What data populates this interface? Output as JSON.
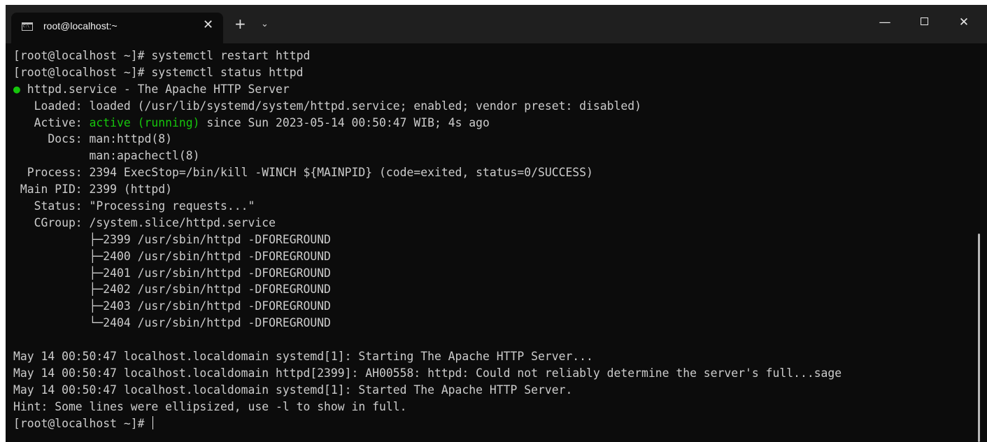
{
  "window": {
    "tab_title": "root@localhost:~",
    "tab_icon": "terminal-icon",
    "close_tab_glyph": "✕",
    "new_tab_glyph": "+",
    "dropdown_glyph": "⌄",
    "minimize_glyph": "—",
    "close_glyph": "✕"
  },
  "colors": {
    "background": "#0c0c0c",
    "titlebar": "#1f1f1f",
    "text": "#cccccc",
    "status_green": "#16c60c"
  },
  "terminal": {
    "lines": [
      "[root@localhost ~]# systemctl restart httpd",
      "[root@localhost ~]# systemctl status httpd",
      " httpd.service - The Apache HTTP Server",
      "   Loaded: loaded (/usr/lib/systemd/system/httpd.service; enabled; vendor preset: disabled)",
      "   Active: ",
      "     Docs: man:httpd(8)",
      "           man:apachectl(8)",
      "  Process: 2394 ExecStop=/bin/kill -WINCH ${MAINPID} (code=exited, status=0/SUCCESS)",
      " Main PID: 2399 (httpd)",
      "   Status: \"Processing requests...\"",
      "   CGroup: /system.slice/httpd.service",
      "           ├─2399 /usr/sbin/httpd -DFOREGROUND",
      "           ├─2400 /usr/sbin/httpd -DFOREGROUND",
      "           ├─2401 /usr/sbin/httpd -DFOREGROUND",
      "           ├─2402 /usr/sbin/httpd -DFOREGROUND",
      "           ├─2403 /usr/sbin/httpd -DFOREGROUND",
      "           └─2404 /usr/sbin/httpd -DFOREGROUND",
      "",
      "May 14 00:50:47 localhost.localdomain systemd[1]: Starting The Apache HTTP Server...",
      "May 14 00:50:47 localhost.localdomain httpd[2399]: AH00558: httpd: Could not reliably determine the server's full...sage",
      "May 14 00:50:47 localhost.localdomain systemd[1]: Started The Apache HTTP Server.",
      "Hint: Some lines were ellipsized, use -l to show in full.",
      "[root@localhost ~]# "
    ],
    "status_bullet": "●",
    "active_state": "active (running)",
    "active_rest": " since Sun 2023-05-14 00:50:47 WIB; 4s ago"
  }
}
